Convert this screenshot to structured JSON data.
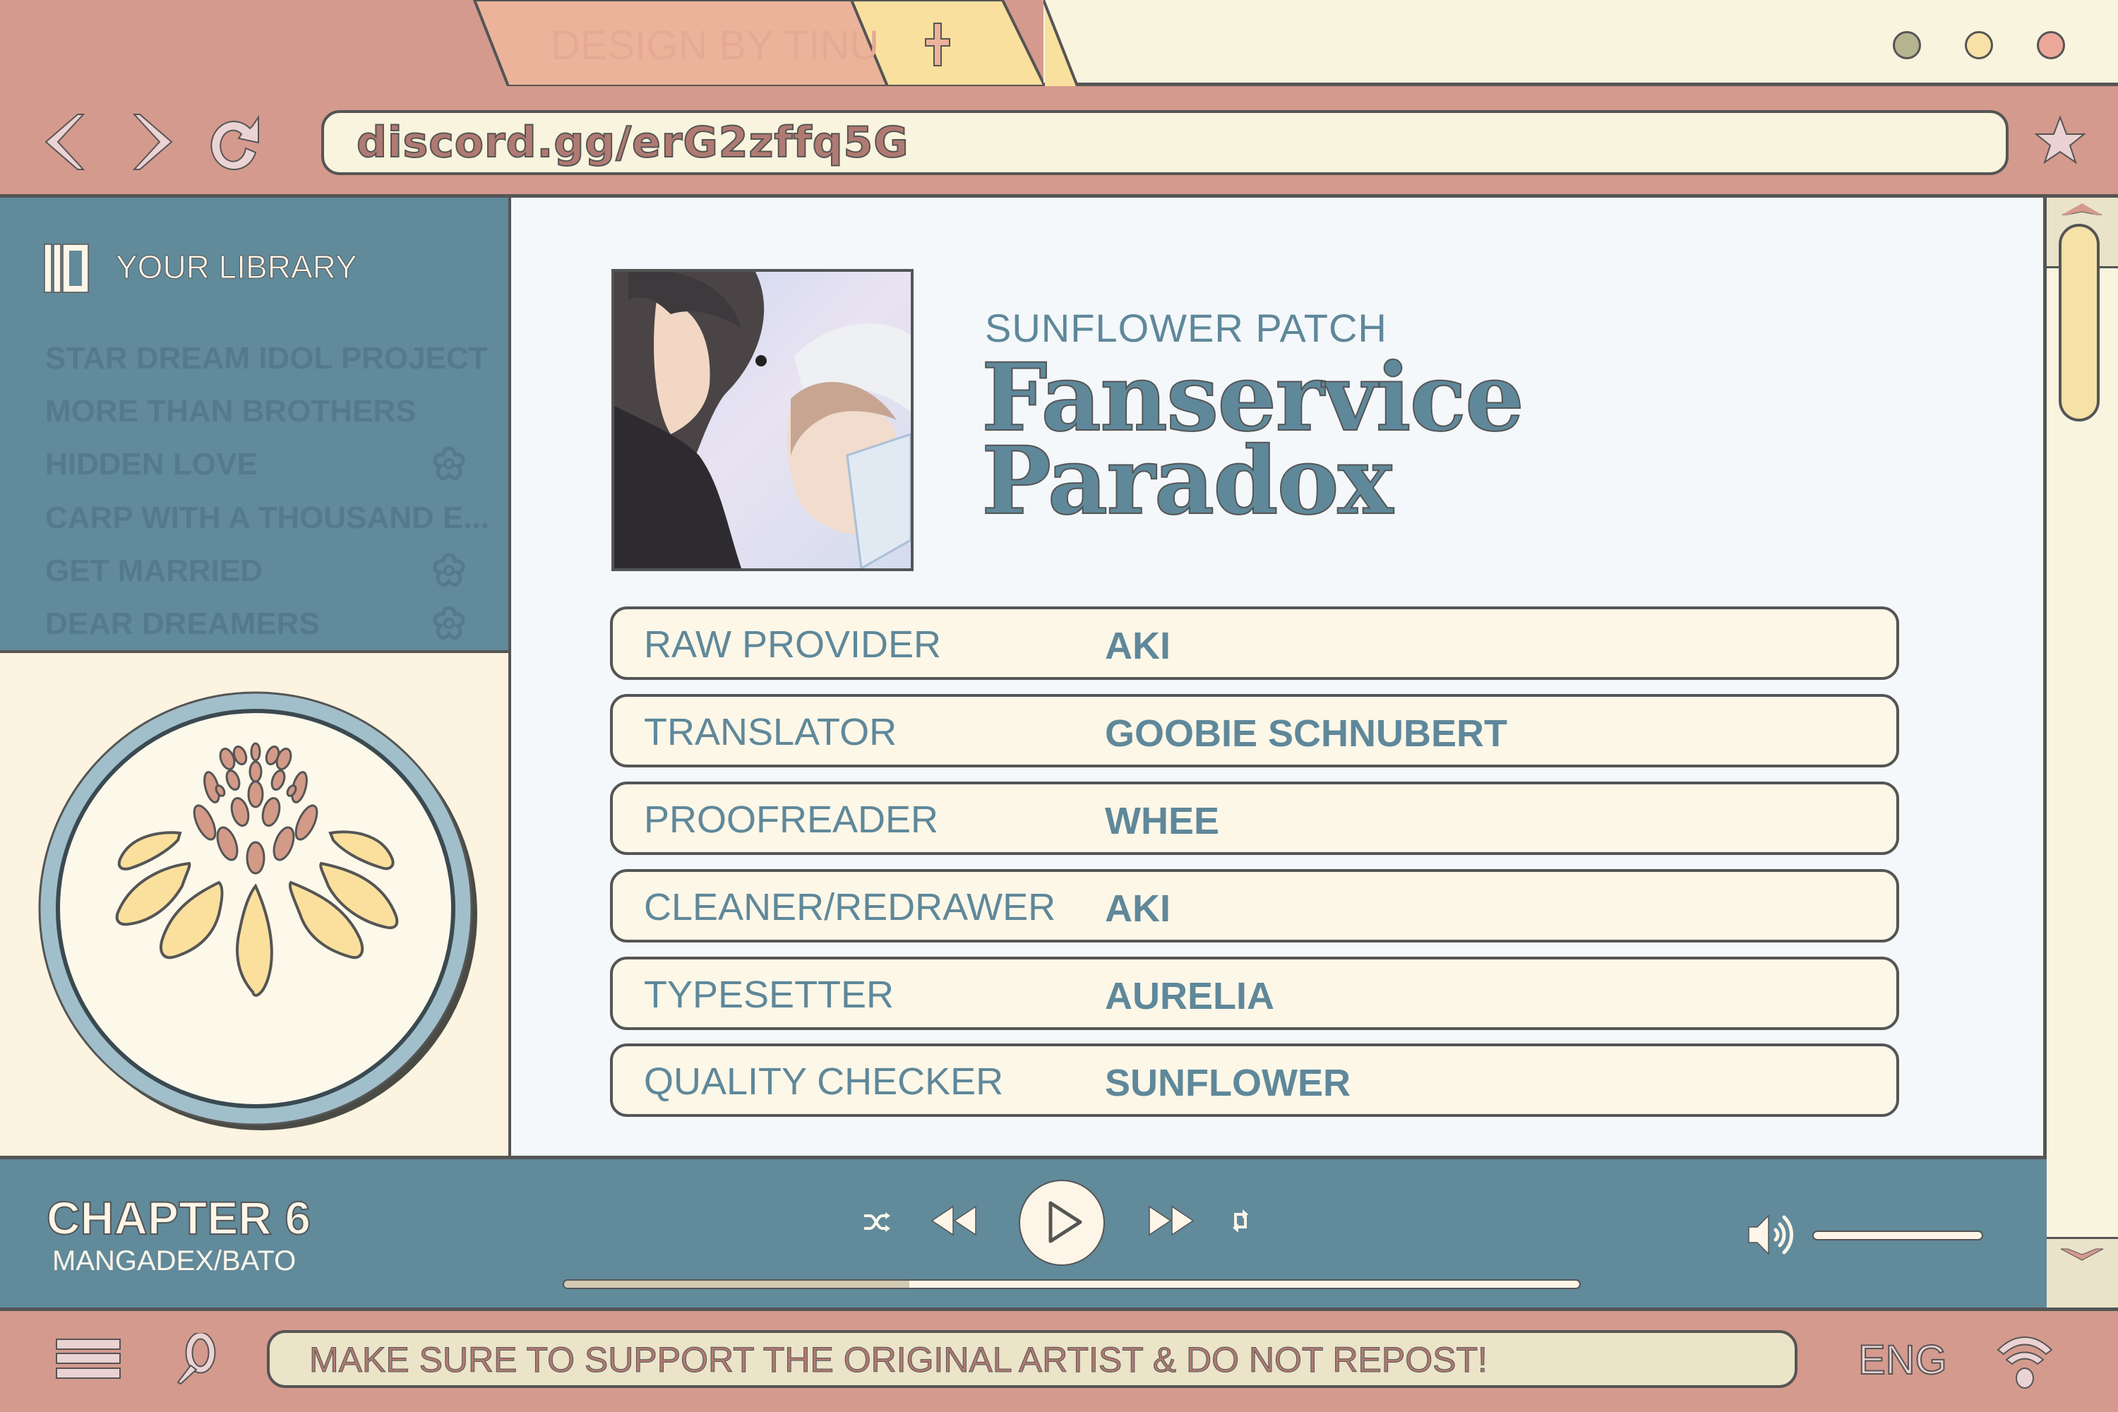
{
  "titlebar": {
    "watermark": "DESIGN BY TINU",
    "new_tab_icon": "plus-icon",
    "window_controls": [
      {
        "name": "minimize",
        "color": "#b4b48f"
      },
      {
        "name": "maximize",
        "color": "#f6e1a6"
      },
      {
        "name": "close",
        "color": "#eba89a"
      }
    ]
  },
  "navbar": {
    "back_icon": "chevron-left-icon",
    "forward_icon": "chevron-right-icon",
    "reload_icon": "reload-icon",
    "url": "discord.gg/erG2zffq5G",
    "bookmark_icon": "star-icon"
  },
  "sidebar": {
    "title": "YOUR LIBRARY",
    "title_icon": "library-icon",
    "items": [
      {
        "label": "STAR DREAM IDOL PROJECT",
        "flower": false
      },
      {
        "label": "MORE THAN BROTHERS",
        "flower": false
      },
      {
        "label": "HIDDEN LOVE",
        "flower": true
      },
      {
        "label": "CARP WITH A THOUSAND E...",
        "flower": false
      },
      {
        "label": "GET MARRIED",
        "flower": true
      },
      {
        "label": "DEAR DREAMERS",
        "flower": true
      }
    ]
  },
  "main": {
    "group": "SUNFLOWER PATCH",
    "title_line1": "Fanservice",
    "title_line2": "Paradox",
    "credits": [
      {
        "role": "RAW PROVIDER",
        "name": "AKI"
      },
      {
        "role": "TRANSLATOR",
        "name": "GOOBIE SCHNUBERT"
      },
      {
        "role": "PROOFREADER",
        "name": "WHEE"
      },
      {
        "role": "CLEANER/REDRAWER",
        "name": "AKI"
      },
      {
        "role": "TYPESETTER",
        "name": "AURELIA"
      },
      {
        "role": "QUALITY CHECKER",
        "name": "SUNFLOWER"
      }
    ]
  },
  "player": {
    "chapter": "CHAPTER 6",
    "source": "MANGADEX/BATO",
    "progress_percent": 34,
    "volume_percent": 100,
    "controls": [
      "shuffle-icon",
      "rewind-icon",
      "play-icon",
      "fast-forward-icon",
      "repeat-icon"
    ]
  },
  "statusbar": {
    "menu_icon": "menu-icon",
    "search_icon": "search-icon",
    "notice": "MAKE SURE TO SUPPORT THE ORIGINAL ARTIST & DO NOT REPOST!",
    "language": "ENG",
    "wifi_icon": "wifi-icon"
  },
  "colors": {
    "rose": "#d49a8d",
    "teal": "#618a9b",
    "cream": "#f9f4de",
    "yellow": "#f6e1a6",
    "ink": "#555555"
  }
}
